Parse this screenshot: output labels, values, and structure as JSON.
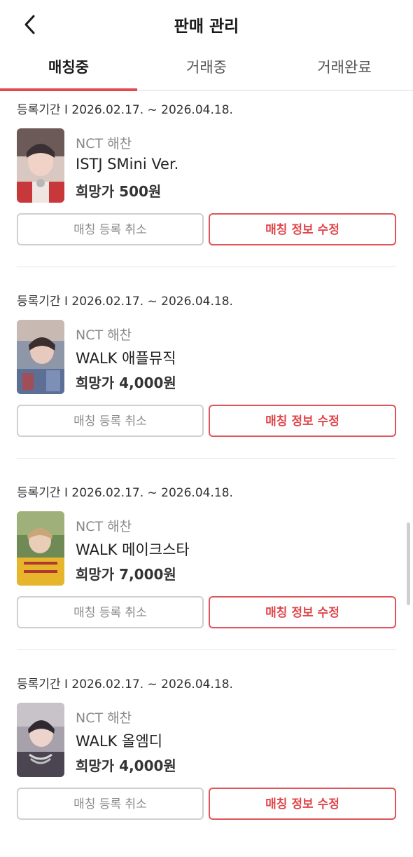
{
  "header": {
    "title": "판매 관리"
  },
  "tabs": [
    {
      "label": "매칭중",
      "active": true
    },
    {
      "label": "거래중",
      "active": false
    },
    {
      "label": "거래완료",
      "active": false
    }
  ],
  "accent_color": "#e24a4f",
  "items": [
    {
      "period": "등록기간 I 2026.02.17. ~ 2026.04.18.",
      "artist": "NCT 해찬",
      "version": "ISTJ SMini Ver.",
      "price": "희망가 500원",
      "cancel_label": "매칭 등록 취소",
      "edit_label": "매칭 정보 수정"
    },
    {
      "period": "등록기간 I 2026.02.17. ~ 2026.04.18.",
      "artist": "NCT 해찬",
      "version": "WALK 애플뮤직",
      "price": "희망가 4,000원",
      "cancel_label": "매칭 등록 취소",
      "edit_label": "매칭 정보 수정"
    },
    {
      "period": "등록기간 I 2026.02.17. ~ 2026.04.18.",
      "artist": "NCT 해찬",
      "version": "WALK 메이크스타",
      "price": "희망가 7,000원",
      "cancel_label": "매칭 등록 취소",
      "edit_label": "매칭 정보 수정"
    },
    {
      "period": "등록기간 I 2026.02.17. ~ 2026.04.18.",
      "artist": "NCT 해찬",
      "version": "WALK 올엠디",
      "price": "희망가 4,000원",
      "cancel_label": "매칭 등록 취소",
      "edit_label": "매칭 정보 수정"
    }
  ]
}
